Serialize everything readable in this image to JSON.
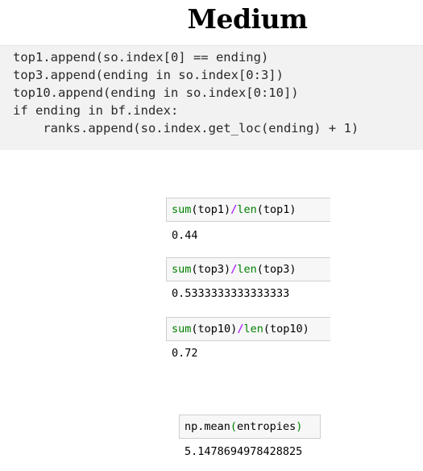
{
  "header": {
    "logo_text": "Medium"
  },
  "code": {
    "lines": [
      "top1.append(so.index[0] == ending)",
      "top3.append(ending in so.index[0:3])",
      "top10.append(ending in so.index[0:10])",
      "if ending in bf.index:",
      "    ranks.append(so.index.get_loc(ending) + 1)"
    ]
  },
  "cells": [
    {
      "fn1": "sum",
      "arg1": "(top1)",
      "op": "/",
      "fn2": "len",
      "arg2": "(top1)",
      "output": "0.44"
    },
    {
      "fn1": "sum",
      "arg1": "(top3)",
      "op": "/",
      "fn2": "len",
      "arg2": "(top3)",
      "output": "0.5333333333333333"
    },
    {
      "fn1": "sum",
      "arg1": "(top10)",
      "op": "/",
      "fn2": "len",
      "arg2": "(top10)",
      "output": "0.72"
    }
  ],
  "mean_cell": {
    "prefix": "np.mean",
    "open_paren": "(",
    "arg": "entropies",
    "close_paren": ")",
    "output": "5.1478694978428825"
  },
  "colors": {
    "builtin_function": "#008000",
    "operator": "#aa22ff",
    "code_block_bg": "#f2f2f2"
  }
}
